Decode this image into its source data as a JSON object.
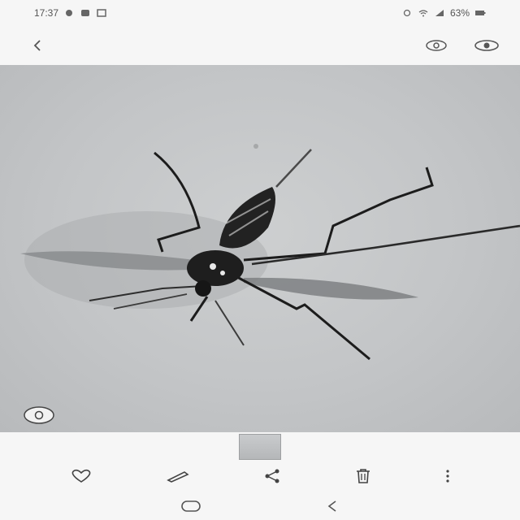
{
  "status": {
    "time": "17:37",
    "battery": "63%",
    "left_icons": [
      "notification-icon",
      "settings-icon",
      "gallery-icon"
    ],
    "right_icons": [
      "alarm-icon",
      "wifi-icon",
      "signal-icon",
      "battery-icon"
    ]
  },
  "top_bar": {
    "back_icon": "chevron-left-icon",
    "actions": [
      "visual-enhance-icon",
      "eye-icon"
    ]
  },
  "photo": {
    "subject": "mosquito",
    "background_color": "#c4c6c8"
  },
  "bixby_button_icon": "bixby-vision-icon",
  "bottom_bar": {
    "actions": [
      "favorite-heart-icon",
      "edit-pencil-icon",
      "share-icon",
      "delete-trash-icon",
      "more-options-icon"
    ]
  },
  "nav_bar": {
    "items": [
      "home-icon",
      "back-icon"
    ]
  }
}
